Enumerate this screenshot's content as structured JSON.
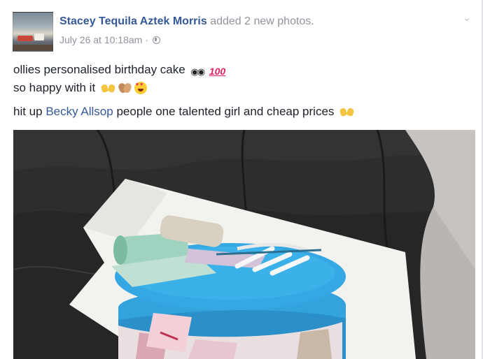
{
  "post": {
    "author_name": "Stacey Tequila Aztek Morris",
    "action": "added 2 new photos.",
    "timestamp": "July 26 at 10:18am",
    "separator": "·",
    "privacy_icon": "globe-icon",
    "options_icon": "chevron-down-icon",
    "line1": "ollies personalised birthday cake",
    "line1_emoji": [
      "eyes-emoji",
      "hundred-points-emoji"
    ],
    "hundred_text": "100",
    "line2": "so happy with it",
    "line2_emoji": [
      "raising-hands-emoji",
      "clapping-hands-emoji",
      "heart-eyes-emoji"
    ],
    "line3_before": "hit up",
    "tagged_name": "Becky Allsop",
    "line3_after": "people one talented girl and cheap prices",
    "line3_emoji": [
      "raising-hands-emoji"
    ],
    "photo": "photo of blue birthday cake with edible banknote decorations on a black leather sofa"
  },
  "colors": {
    "link": "#365899",
    "meta": "#90949c",
    "text": "#1d2129",
    "cake_blue": "#2a9bd5"
  }
}
